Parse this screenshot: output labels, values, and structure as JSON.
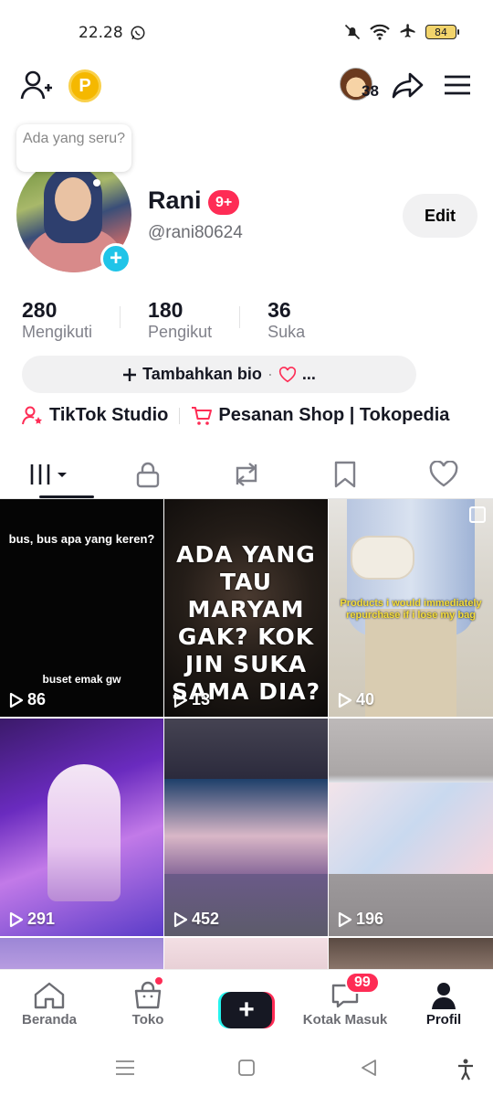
{
  "status_bar": {
    "time": "22.28",
    "battery": "84"
  },
  "header": {
    "coin_letter": "P",
    "visitor_count": "38"
  },
  "profile": {
    "bubble_text": "Ada yang seru?",
    "name": "Rani",
    "notification_badge": "9+",
    "handle": "@rani80624",
    "edit_label": "Edit",
    "stats": [
      {
        "value": "280",
        "label": "Mengikuti"
      },
      {
        "value": "180",
        "label": "Pengikut"
      },
      {
        "value": "36",
        "label": "Suka"
      }
    ],
    "add_bio_label": "Tambahkan bio",
    "add_bio_suffix": "...",
    "link_studio": "TikTok Studio",
    "link_shop": "Pesanan Shop | Tokopedia"
  },
  "videos": [
    {
      "views": "86",
      "caption_top": "bus, bus apa yang keren?",
      "caption_bottom": "buset emak gw"
    },
    {
      "views": "13",
      "caption": "ADA YANG TAU MARYAM GAK? KOK JIN SUKA SAMA DIA?"
    },
    {
      "views": "40",
      "caption": "Products i would immediately repurchase if i lose my bag"
    },
    {
      "views": "291"
    },
    {
      "views": "452"
    },
    {
      "views": "196"
    }
  ],
  "bottom_nav": {
    "home": "Beranda",
    "shop": "Toko",
    "inbox": "Kotak Masuk",
    "inbox_badge": "99",
    "profile": "Profil"
  },
  "colors": {
    "accent_red": "#fe2c55",
    "accent_cyan": "#25f4ee",
    "text_dark": "#161823",
    "coin": "#f5b800"
  }
}
